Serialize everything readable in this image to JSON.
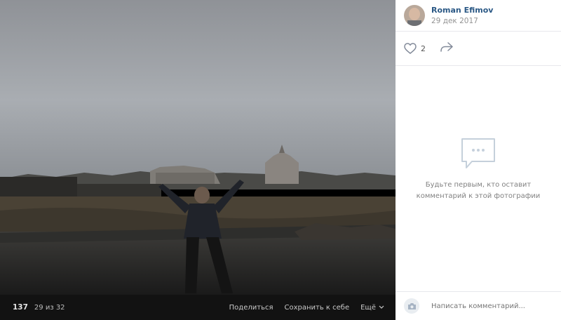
{
  "author": {
    "name": "Roman Efimov",
    "date": "29 дек 2017"
  },
  "actions": {
    "likes": "2",
    "like_icon": "heart-icon",
    "share_icon": "share-arrow-icon"
  },
  "comments": {
    "empty_line1": "Будьте первым, кто оставит",
    "empty_line2": "комментарий к этой фотографии",
    "placeholder": "Написать комментарий..."
  },
  "photo_bar": {
    "views": "137",
    "counter": "29 из 32",
    "share": "Поделиться",
    "save": "Сохранить к себе",
    "more": "Ещё"
  },
  "colors": {
    "link": "#2a5885",
    "muted": "#939393",
    "bar": "#121212"
  }
}
